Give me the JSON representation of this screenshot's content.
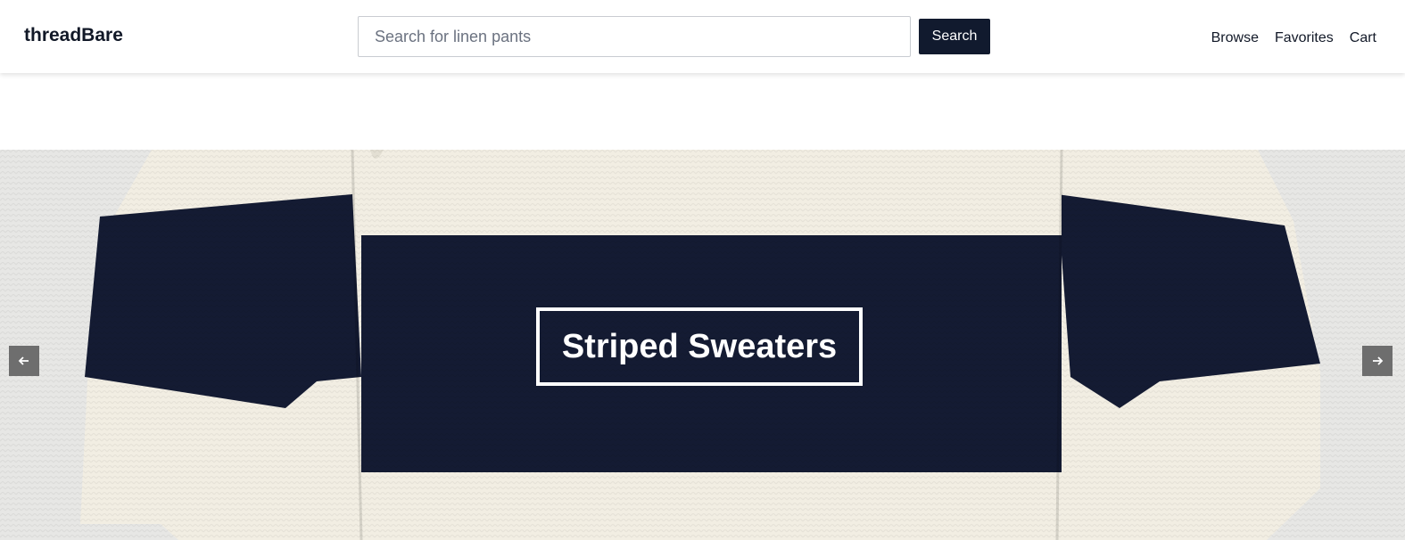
{
  "header": {
    "logo": "threadBare",
    "search": {
      "placeholder": "Search for linen pants",
      "value": "",
      "button_label": "Search"
    },
    "nav": [
      "Browse",
      "Favorites",
      "Cart"
    ]
  },
  "hero": {
    "caption": "Striped Sweaters",
    "image": "navy-cream-striped-sweater",
    "prev_icon": "arrow-left-icon",
    "next_icon": "arrow-right-icon",
    "colors": {
      "cream": "#f2eee3",
      "navy": "#141b33",
      "backdrop": "#e7e7e5"
    }
  }
}
